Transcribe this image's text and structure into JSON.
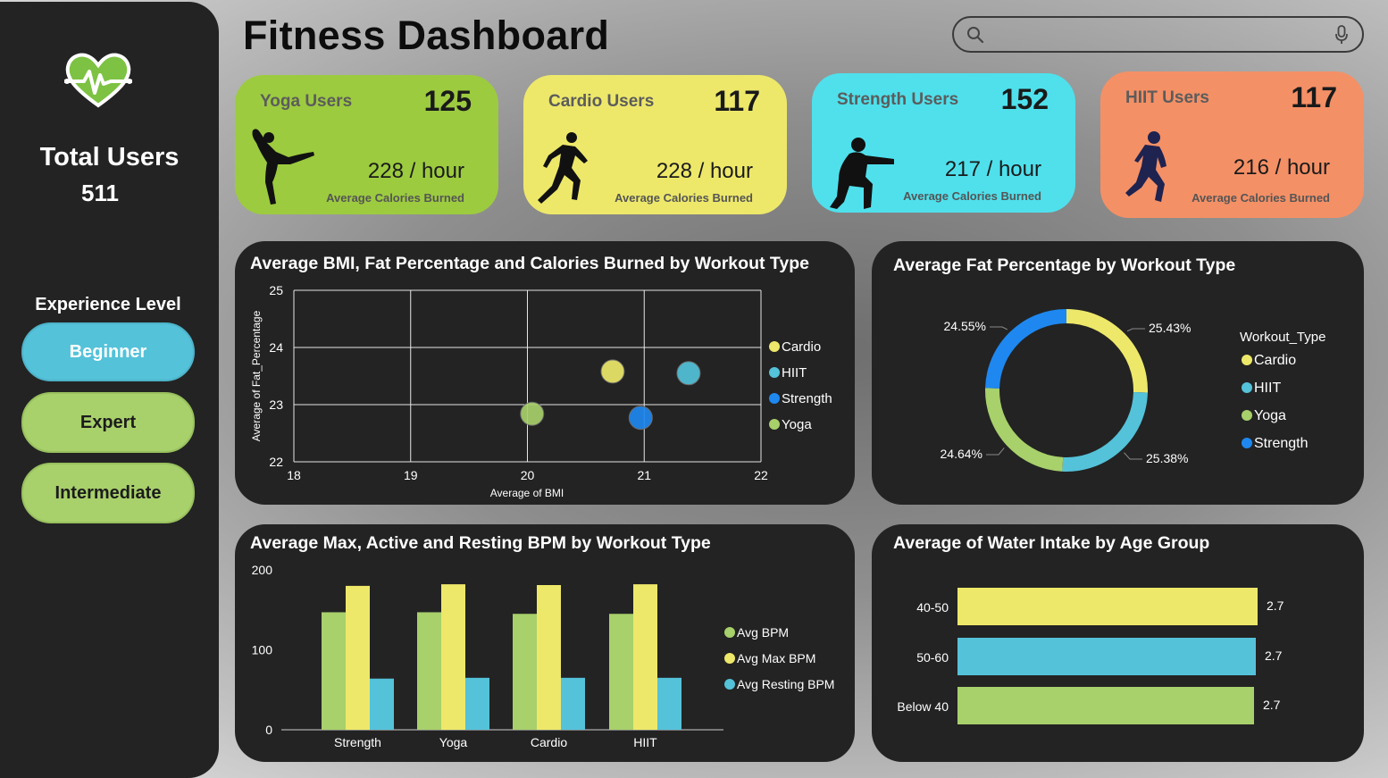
{
  "sidebar": {
    "total_label": "Total Users",
    "total_value": "511",
    "experience_label": "Experience Level",
    "experience_levels": [
      {
        "label": "Beginner",
        "selected": true
      },
      {
        "label": "Expert",
        "selected": false
      },
      {
        "label": "Intermediate",
        "selected": false
      }
    ],
    "logo_icon": "heart-pulse-icon"
  },
  "header": {
    "title": "Fitness Dashboard",
    "search_placeholder": "",
    "search_icon": "search-icon",
    "mic_icon": "microphone-icon"
  },
  "kpis": [
    {
      "label": "Yoga Users",
      "count": "125",
      "rate": "228 / hour",
      "sub": "Average Calories Burned",
      "color": "#9ccb3f",
      "icon": "yoga-pose-icon"
    },
    {
      "label": "Cardio Users",
      "count": "117",
      "rate": "228 / hour",
      "sub": "Average Calories Burned",
      "color": "#ede86a",
      "icon": "runner-icon"
    },
    {
      "label": "Strength Users",
      "count": "152",
      "rate": "217 / hour",
      "sub": "Average Calories Burned",
      "color": "#4fe0ec",
      "icon": "squat-icon"
    },
    {
      "label": "HIIT Users",
      "count": "117",
      "rate": "216 / hour",
      "sub": "Average Calories Burned",
      "color": "#f49066",
      "icon": "sprinter-icon"
    }
  ],
  "colors": {
    "Cardio": "#ede86a",
    "HIIT": "#54c2d9",
    "Strength": "#1e88f0",
    "Yoga": "#a8d06b"
  },
  "charts": {
    "scatter": {
      "title": "Average BMI, Fat Percentage and Calories Burned by Workout Type",
      "xlabel": "Average of BMI",
      "ylabel": "Average of Fat_Percentage"
    },
    "donut": {
      "title": "Average Fat Percentage by Workout Type",
      "legend_title": "Workout_Type"
    },
    "bpm": {
      "title": "Average Max, Active and Resting BPM by Workout Type"
    },
    "water": {
      "title": "Average of Water Intake by Age Group"
    }
  },
  "chart_data": [
    {
      "type": "scatter",
      "title": "Average BMI, Fat Percentage and Calories Burned by Workout Type",
      "xlabel": "Average of BMI",
      "ylabel": "Average of Fat_Percentage",
      "xlim": [
        18,
        22
      ],
      "ylim": [
        22,
        25
      ],
      "xticks": [
        18,
        19,
        20,
        21,
        22
      ],
      "yticks": [
        22,
        23,
        24,
        25
      ],
      "grid": true,
      "legend": "right",
      "series": [
        {
          "name": "Cardio",
          "x": 20.73,
          "y": 23.58
        },
        {
          "name": "HIIT",
          "x": 21.38,
          "y": 23.55
        },
        {
          "name": "Strength",
          "x": 20.97,
          "y": 22.77
        },
        {
          "name": "Yoga",
          "x": 20.04,
          "y": 22.84
        }
      ]
    },
    {
      "type": "pie",
      "title": "Average Fat Percentage by Workout Type",
      "legend_title": "Workout_Type",
      "legend": "right",
      "slices": [
        {
          "name": "Cardio",
          "value": 25.43,
          "label": "25.43%"
        },
        {
          "name": "HIIT",
          "value": 25.38,
          "label": "25.38%"
        },
        {
          "name": "Yoga",
          "value": 24.64,
          "label": "24.64%"
        },
        {
          "name": "Strength",
          "value": 24.55,
          "label": "24.55%"
        }
      ]
    },
    {
      "type": "bar",
      "title": "Average Max, Active and Resting BPM by Workout Type",
      "categories": [
        "Strength",
        "Yoga",
        "Cardio",
        "HIIT"
      ],
      "ylim": [
        0,
        200
      ],
      "yticks": [
        0,
        100,
        200
      ],
      "legend": "right",
      "series": [
        {
          "name": "Avg BPM",
          "color": "#a8d06b",
          "values": [
            147,
            147,
            145,
            145
          ]
        },
        {
          "name": "Avg Max BPM",
          "color": "#ede86a",
          "values": [
            180,
            182,
            181,
            182
          ]
        },
        {
          "name": "Avg Resting BPM",
          "color": "#54c2d9",
          "values": [
            64,
            65,
            65,
            65
          ]
        }
      ]
    },
    {
      "type": "bar",
      "orientation": "horizontal",
      "title": "Average of Water Intake by Age Group",
      "categories": [
        "40-50",
        "50-60",
        "Below 40"
      ],
      "values": [
        2.7,
        2.7,
        2.7
      ],
      "value_labels": [
        "2.7",
        "2.7",
        "2.7"
      ],
      "colors": [
        "#ede86a",
        "#54c2d9",
        "#a8d06b"
      ]
    }
  ]
}
